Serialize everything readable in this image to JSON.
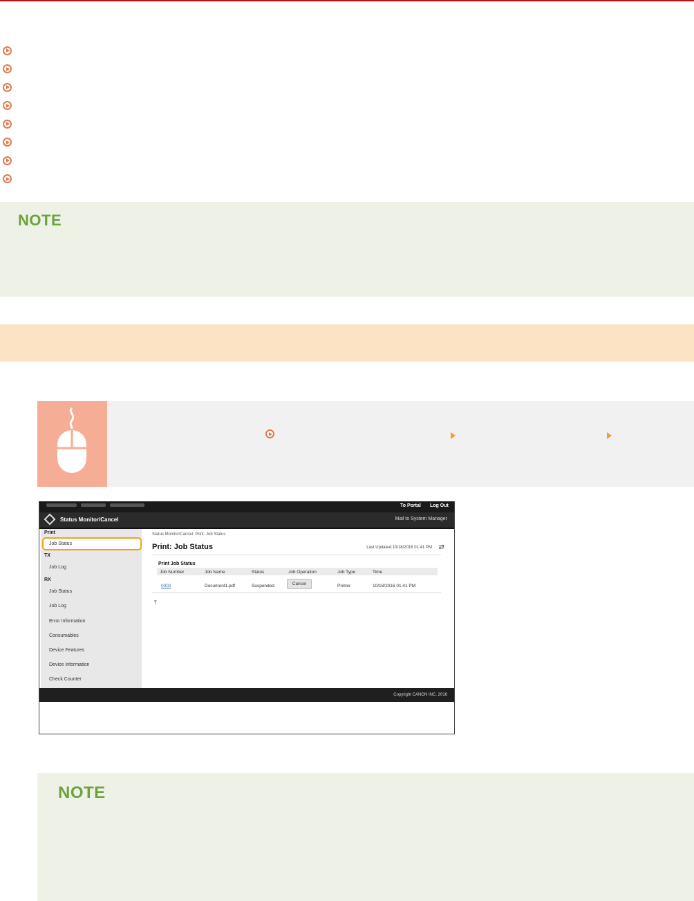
{
  "accent_color": "#c0121b",
  "link_icon": "circle-arrow-icon",
  "link_list": {
    "count": 8
  },
  "note1": {
    "title": "NOTE"
  },
  "step": {
    "icon": "mouse-icon",
    "arrow_icon": "orange-triangle-icon"
  },
  "remote_ui": {
    "top_links": {
      "portal": "To Portal",
      "logout": "Log Out"
    },
    "header_title": "Status Monitor/Cancel",
    "mail_link": "Mail to System Manager",
    "sidebar": {
      "print_group": "Print",
      "print_job_status": "Job Status",
      "tx_group": "TX",
      "tx_job_log": "Job Log",
      "rx_group": "RX",
      "rx_job_status": "Job Status",
      "rx_job_log": "Job Log",
      "error_info": "Error Information",
      "consumables": "Consumables",
      "device_features": "Device Features",
      "device_info": "Device Information",
      "check_counter": "Check Counter"
    },
    "breadcrumb": "Status Monitor/Cancel: Print: Job Status",
    "page_title": "Print: Job Status",
    "last_updated": "Last Updated:10/18/2016 01:41 PM",
    "section_title": "Print Job Status",
    "columns": [
      "Job Number",
      "Job Name",
      "Status",
      "Job Operation",
      "Job Type",
      "Time"
    ],
    "row": {
      "job_number": "0002",
      "job_name": "Document1.pdf",
      "status": "Suspended",
      "operation_button": "Cancel",
      "job_type": "Printer",
      "time": "10/18/2016 01:41 PM"
    },
    "footer": "Copyright CANON INC. 2016"
  },
  "note2": {
    "title": "NOTE"
  }
}
